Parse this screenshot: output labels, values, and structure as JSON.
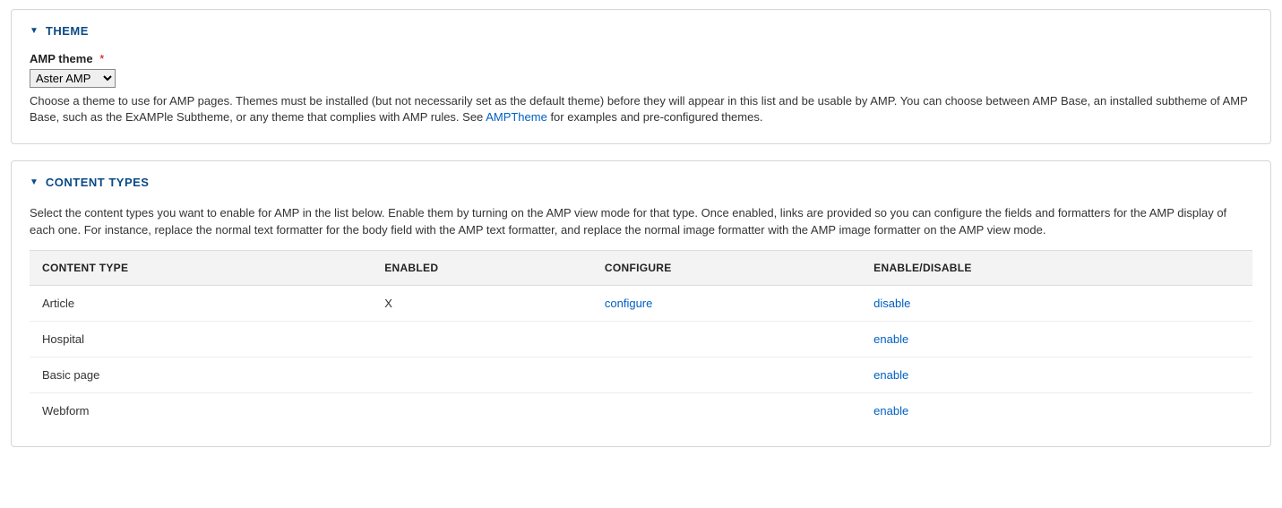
{
  "theme_panel": {
    "title": "THEME",
    "field_label": "AMP theme",
    "required_symbol": "*",
    "selected_option": "Aster AMP",
    "description_before_link": "Choose a theme to use for AMP pages. Themes must be installed (but not necessarily set as the default theme) before they will appear in this list and be usable by AMP. You can choose between AMP Base, an installed subtheme of AMP Base, such as the ExAMPle Subtheme, or any theme that complies with AMP rules. See ",
    "description_link_text": "AMPTheme",
    "description_after_link": " for examples and pre-configured themes."
  },
  "content_types_panel": {
    "title": "CONTENT TYPES",
    "intro": "Select the content types you want to enable for AMP in the list below. Enable them by turning on the AMP view mode for that type. Once enabled, links are provided so you can configure the fields and formatters for the AMP display of each one. For instance, replace the normal text formatter for the body field with the AMP text formatter, and replace the normal image formatter with the AMP image formatter on the AMP view mode.",
    "columns": {
      "content_type": "CONTENT TYPE",
      "enabled": "ENABLED",
      "configure": "CONFIGURE",
      "enable_disable": "ENABLE/DISABLE"
    },
    "rows": [
      {
        "name": "Article",
        "enabled": "X",
        "configure": "configure",
        "toggle": "disable"
      },
      {
        "name": "Hospital",
        "enabled": "",
        "configure": "",
        "toggle": "enable"
      },
      {
        "name": "Basic page",
        "enabled": "",
        "configure": "",
        "toggle": "enable"
      },
      {
        "name": "Webform",
        "enabled": "",
        "configure": "",
        "toggle": "enable"
      }
    ]
  }
}
